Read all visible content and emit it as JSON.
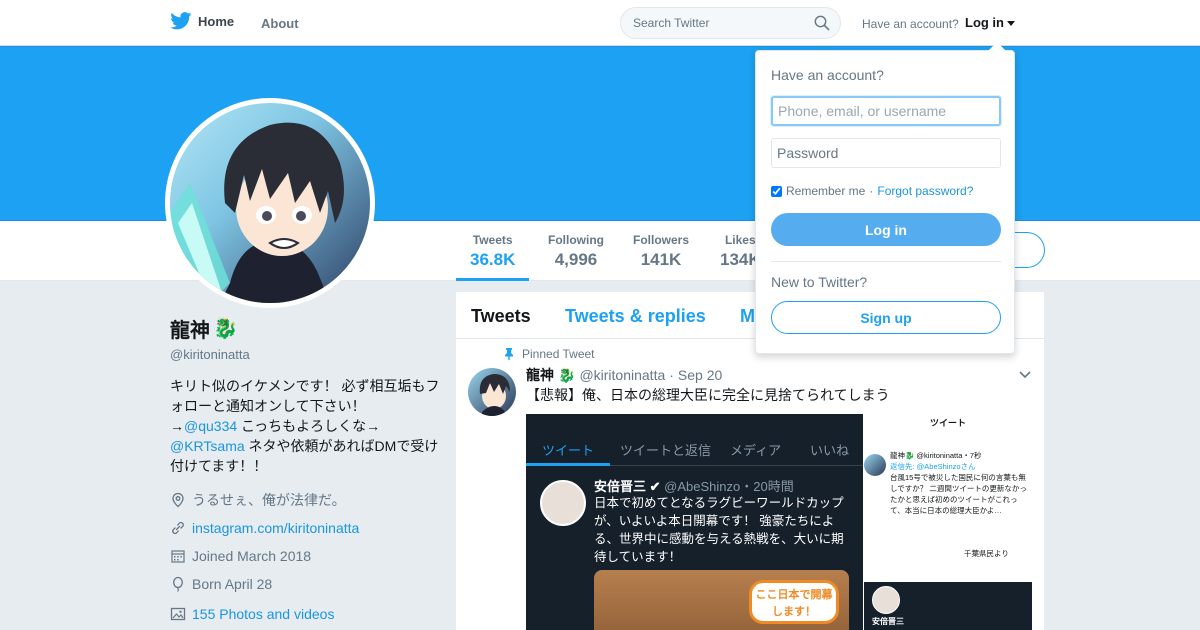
{
  "topnav": {
    "home_label": "Home",
    "about_label": "About",
    "search_placeholder": "Search Twitter",
    "have_account": "Have an account?",
    "login_label": "Log in"
  },
  "colors": {
    "accent": "#1da1f2",
    "banner": "#1da1f2",
    "login_button": "#55acee",
    "background": "#e6ecf0"
  },
  "profile": {
    "name": "龍神",
    "name_emoji": "🐉",
    "handle": "@kiritoninatta",
    "bio": {
      "line1": "キリト似のイケメンです！ 必ず相互垢もフォローと通知オンして下さい！",
      "arrow1": "→",
      "mention1": "@qu334",
      "text1": " こっちもよろしくな→",
      "mention2": "@KRTsama",
      "text2": " ネタや依頼があればDMで受け付けてます！！"
    },
    "location": "うるせぇ、俺が法律だ。",
    "website": "instagram.com/kiritoninatta",
    "joined": "Joined March 2018",
    "born": "Born April 28",
    "photos": "155 Photos and videos"
  },
  "stats": [
    {
      "label": "Tweets",
      "value": "36.8K"
    },
    {
      "label": "Following",
      "value": "4,996"
    },
    {
      "label": "Followers",
      "value": "141K"
    },
    {
      "label": "Likes",
      "value": "134K"
    }
  ],
  "timeline": {
    "tabs": [
      "Tweets",
      "Tweets & replies",
      "M"
    ],
    "pinned_label": "Pinned Tweet",
    "tweet": {
      "name": "龍神",
      "handle": "@kiritoninatta",
      "sep": "·",
      "date": "Sep 20",
      "text": "【悲報】俺、日本の総理大臣に完全に見捨てられてしまう"
    },
    "embedded_left": {
      "tabs": [
        "ツイート",
        "ツイートと返信",
        "メディア",
        "いいね"
      ],
      "author": "安倍晋三",
      "author_handle": "@AbeShinzo・20時間",
      "body": "日本で初めてとなるラグビーワールドカップが、いよいよ本日開幕です！ 強豪たちによる、世界中に感動を与える熱戦を、大いに期待しています！",
      "bubble": "ここ日本で開幕します！"
    },
    "embedded_right": {
      "title": "ツイート",
      "reply_line": "龍神🐉 @kiritoninatta・7秒",
      "reply_to": "返信先: @AbeShinzoさん",
      "body": "台風15号で被災した国民に何の言葉も無しですか？ 二週間ツイートの更新なかったかと思えば初めのツイートがこれって、本当に日本の総理大臣かよ…",
      "signature": "千葉県民より",
      "footer_name": "安倍晋三"
    }
  },
  "login_dropdown": {
    "title": "Have an account?",
    "username_placeholder": "Phone, email, or username",
    "password_placeholder": "Password",
    "remember_me": "Remember me",
    "separator": " · ",
    "forgot_password": "Forgot password?",
    "login_button": "Log in",
    "new_to_twitter": "New to Twitter?",
    "signup_button": "Sign up"
  }
}
